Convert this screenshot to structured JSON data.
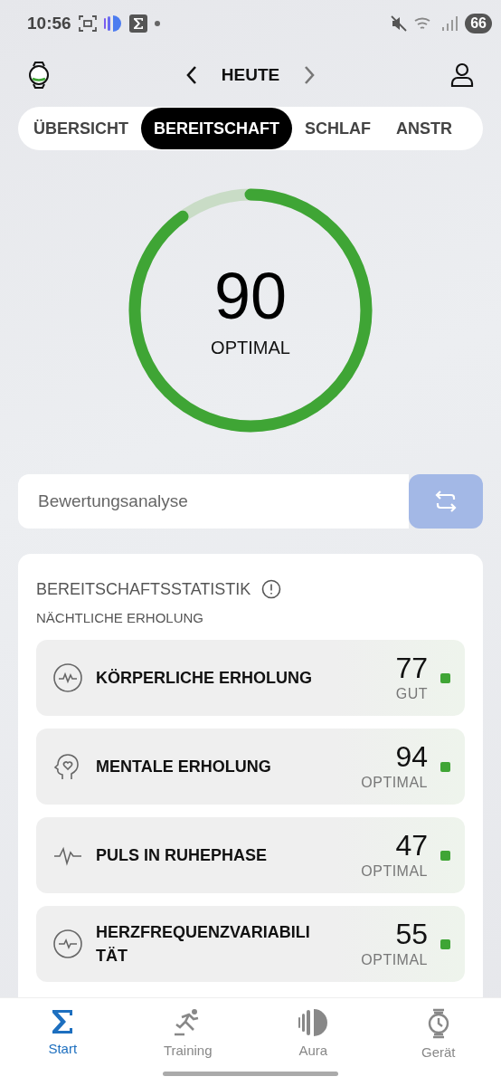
{
  "status_bar": {
    "time": "10:56",
    "battery": "66"
  },
  "header": {
    "title": "HEUTE"
  },
  "tabs": [
    {
      "label": "ÜBERSICHT",
      "selected": false
    },
    {
      "label": "BEREITSCHAFT",
      "selected": true
    },
    {
      "label": "SCHLAF",
      "selected": false
    },
    {
      "label": "ANSTR",
      "selected": false
    }
  ],
  "score": {
    "value": "90",
    "rating": "OPTIMAL",
    "level": 0.9
  },
  "analysis": {
    "placeholder": "Bewertungsanalyse"
  },
  "stats": {
    "title": "BEREITSCHAFTSSTATISTIK",
    "subtitle": "NÄCHTLICHE ERHOLUNG",
    "metrics": [
      {
        "kind": "body",
        "label": "KÖRPERLICHE ERHOLUNG",
        "value": "77",
        "rating": "GUT",
        "color": "#3fa535"
      },
      {
        "kind": "mind",
        "label": "MENTALE ERHOLUNG",
        "value": "94",
        "rating": "OPTIMAL",
        "color": "#3fa535"
      },
      {
        "kind": "pulse",
        "label": "PULS IN RUHEPHASE",
        "value": "47",
        "rating": "OPTIMAL",
        "color": "#3fa535"
      },
      {
        "kind": "hrv",
        "label": "HERZFREQUENZVARIABILITÄT",
        "value": "55",
        "rating": "OPTIMAL",
        "color": "#3fa535"
      }
    ]
  },
  "nav": [
    {
      "kind": "start",
      "label": "Start",
      "selected": true
    },
    {
      "kind": "training",
      "label": "Training",
      "selected": false
    },
    {
      "kind": "aura",
      "label": "Aura",
      "selected": false
    },
    {
      "kind": "device",
      "label": "Gerät",
      "selected": false
    }
  ]
}
